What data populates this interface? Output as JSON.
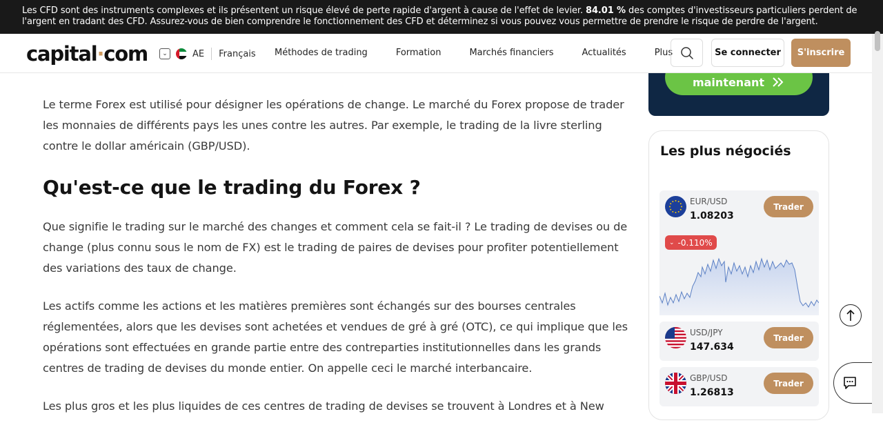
{
  "risk_banner": {
    "text_before": "Les CFD sont des instruments complexes et ils présentent un risque élevé de perte rapide d'argent à cause de l'effet de levier. ",
    "percent": "84.01 %",
    "text_after": " des comptes d'investisseurs particuliers perdent de l'argent en tradant des CFD. Assurez-vous de bien comprendre le fonctionnement des CFD et déterminez si vous pouvez vous permettre de prendre le risque de perdre de l'argent."
  },
  "header": {
    "logo_part1": "capital",
    "logo_dot": "·",
    "logo_part2": "com",
    "region_code": "AE",
    "language": "Français",
    "nav": [
      "Méthodes de trading",
      "Formation",
      "Marchés financiers",
      "Actualités",
      "Plus"
    ],
    "login_label": "Se connecter",
    "signup_label": "S'inscrire"
  },
  "article": {
    "intro_paragraph": "Le terme Forex est utilisé pour désigner les opérations de change. Le marché du Forex propose de trader les monnaies de différents pays les unes contre les autres. Par exemple, le trading de la livre sterling contre le dollar américain (GBP/USD).",
    "heading": "Qu'est-ce que le trading du Forex ?",
    "paragraph_1": "Que signifie le trading sur le marché des changes et comment cela se fait-il ? Le trading de devises ou de change (plus connu sous le nom de FX) est le trading de paires de devises pour profiter potentiellement des variations des taux de change.",
    "paragraph_2": "Les actifs comme les actions et les matières premières sont échangés sur des bourses centrales réglementées, alors que les devises sont achetées et vendues de gré à gré (OTC), ce qui implique que les opérations sont effectuées en grande partie entre des contreparties institutionnelles dans les grands centres de trading de devises du monde entier. On appelle ceci le marché interbancaire.",
    "paragraph_3": "Les plus gros et les plus liquides de ces centres de trading de devises se trouvent à Londres et à New"
  },
  "promo": {
    "button_label": "maintenant"
  },
  "most_traded": {
    "title": "Les plus négociés",
    "instruments": [
      {
        "symbol": "EUR/USD",
        "price": "1.08203",
        "change": "-0.110%",
        "trade_label": "Trader"
      },
      {
        "symbol": "USD/JPY",
        "price": "147.634",
        "trade_label": "Trader"
      },
      {
        "symbol": "GBP/USD",
        "price": "1.26813",
        "trade_label": "Trader"
      }
    ]
  },
  "colors": {
    "banner_bg": "#191919",
    "accent_brown": "#bf8f5f",
    "promo_bg": "#0f2744",
    "promo_green": "#6bc445",
    "down_red": "#e04a4a"
  },
  "icons": [
    "chevron-down-icon",
    "search-icon",
    "arrow-up-icon",
    "chat-icon",
    "double-chevron-right-icon"
  ]
}
